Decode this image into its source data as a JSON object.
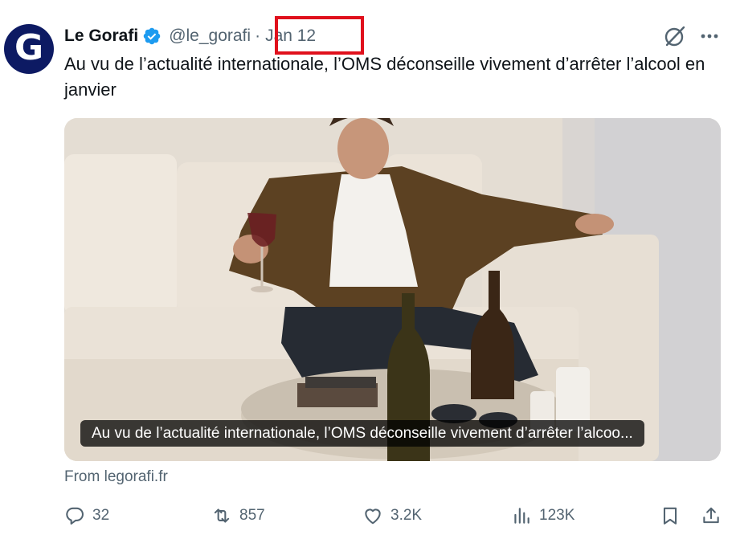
{
  "tweet": {
    "author_name": "Le Gorafi",
    "avatar_letter": "G",
    "handle": "@le_gorafi",
    "separator": "·",
    "date": "Jan 12",
    "text": "Au vu de l’actualité internationale, l’OMS déconseille vivement d’arrêter l’alcool en janvier",
    "media_caption": "Au vu de l’actualité internationale, l’OMS déconseille vivement d’arrêter l’alcoo...",
    "source": "From legorafi.fr"
  },
  "actions": {
    "replies": "32",
    "retweets": "857",
    "likes": "3.2K",
    "views": "123K"
  },
  "icons": {
    "verified": "verified-badge-icon",
    "grok": "grok-icon",
    "more": "more-icon",
    "reply": "reply-icon",
    "retweet": "retweet-icon",
    "like": "like-icon",
    "views": "views-icon",
    "bookmark": "bookmark-icon",
    "share": "share-icon"
  },
  "colors": {
    "text": "#0f1419",
    "secondary": "#536471",
    "verified": "#1d9bf0",
    "avatar_bg": "#0d1a63",
    "highlight_box": "#e0101c"
  }
}
